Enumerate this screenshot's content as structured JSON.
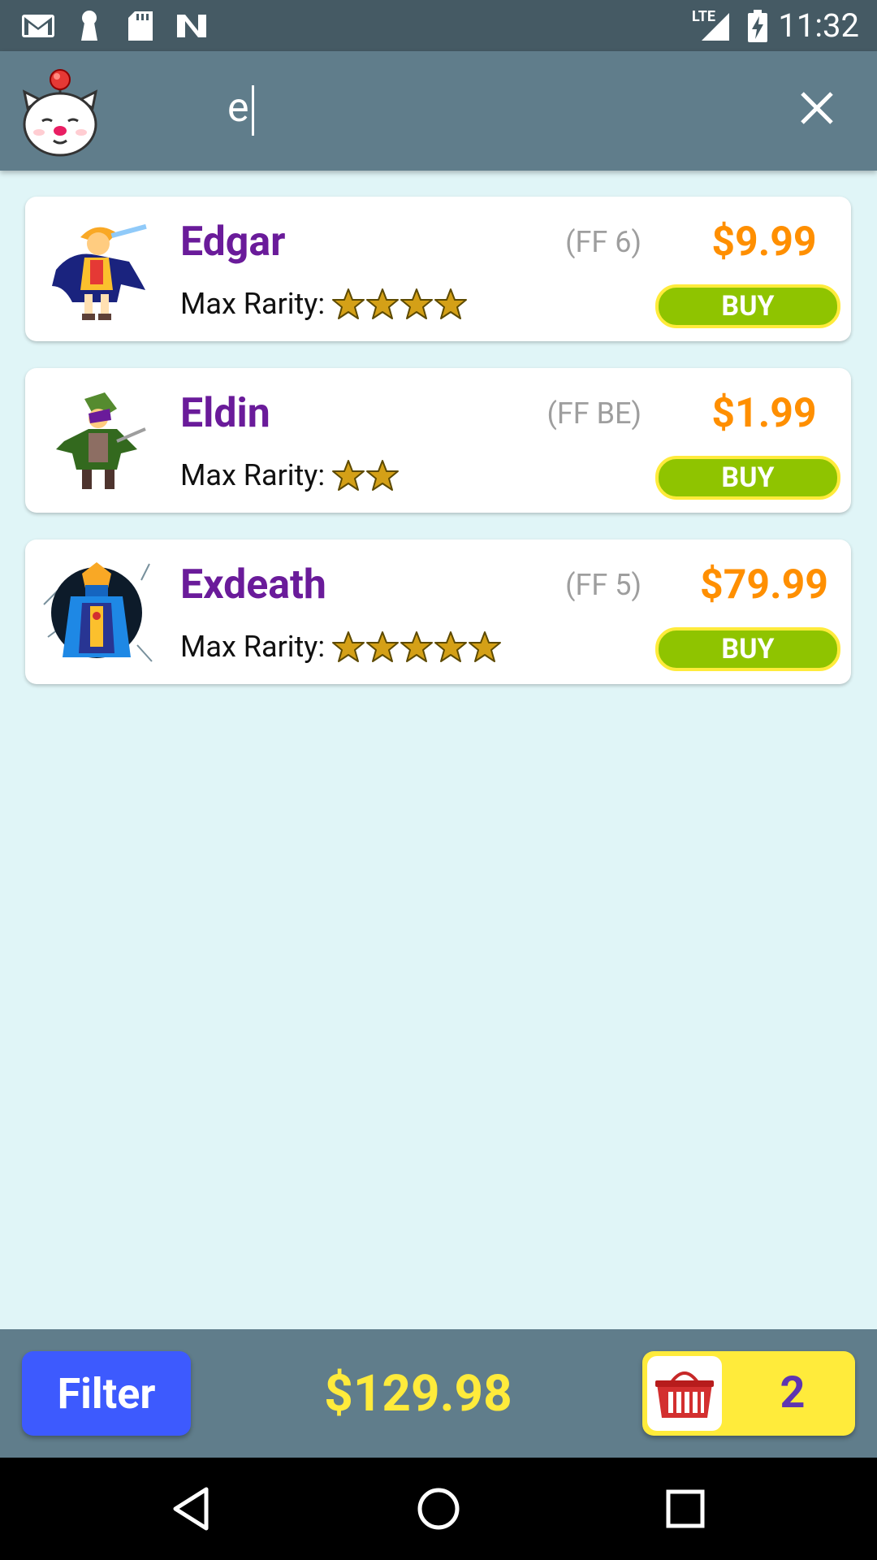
{
  "status_bar": {
    "network": "LTE",
    "time": "11:32",
    "notification_icons": [
      "gmail-icon",
      "keyhole-icon",
      "sd-card-icon",
      "n-icon"
    ]
  },
  "app_bar": {
    "logo": "moogle-icon",
    "search": {
      "value": "e",
      "placeholder": ""
    },
    "close_icon": "close-icon"
  },
  "results": [
    {
      "name": "Edgar",
      "series": "(FF 6)",
      "price": "$9.99",
      "rarity_label": "Max Rarity:",
      "stars": 4,
      "buy_label": "BUY"
    },
    {
      "name": "Eldin",
      "series": "(FF BE)",
      "price": "$1.99",
      "rarity_label": "Max Rarity:",
      "stars": 2,
      "buy_label": "BUY"
    },
    {
      "name": "Exdeath",
      "series": "(FF 5)",
      "price": "$79.99",
      "rarity_label": "Max Rarity:",
      "stars": 5,
      "buy_label": "BUY"
    }
  ],
  "bottom_bar": {
    "filter_label": "Filter",
    "total": "$129.98",
    "cart_count": "2",
    "cart_icon": "basket-icon"
  },
  "nav_bar": {
    "buttons": [
      "back-icon",
      "home-icon",
      "recents-icon"
    ]
  },
  "colors": {
    "app_bar": "#607d8b",
    "status_bar": "#455a64",
    "background": "#e0f5f7",
    "name": "#6a1b9a",
    "price": "#ff8f00",
    "buy": "#8fc400",
    "accent_yellow": "#ffeb3b",
    "filter": "#3d5afe"
  }
}
